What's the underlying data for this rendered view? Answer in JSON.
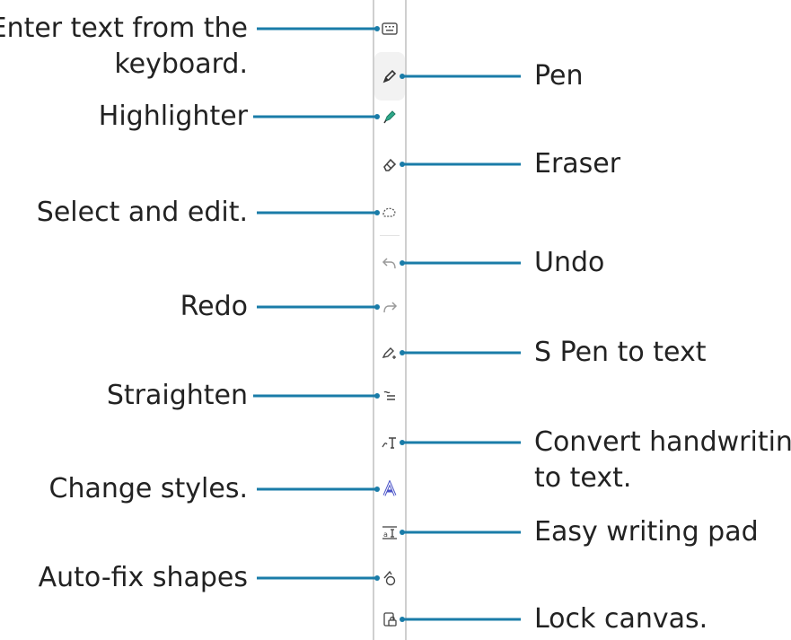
{
  "labels_left": {
    "keyboard_line1": "Enter text from the",
    "keyboard_line2": "keyboard.",
    "highlighter": "Highlighter",
    "select": "Select and edit.",
    "redo": "Redo",
    "straighten": "Straighten",
    "change_styles": "Change styles.",
    "auto_fix": "Auto-fix shapes"
  },
  "labels_right": {
    "pen": "Pen",
    "eraser": "Eraser",
    "undo": "Undo",
    "spen_to_text": "S Pen to text",
    "convert_line1": "Convert handwriting",
    "convert_line2": "to text.",
    "easy_pad": "Easy writing pad",
    "lock_canvas": "Lock canvas."
  },
  "colors": {
    "leader": "#1a7ca8",
    "highlighter_icon": "#2ea98a",
    "styles_icon": "#4a53c8"
  },
  "icons": [
    "keyboard-icon",
    "pen-icon",
    "highlighter-icon",
    "eraser-icon",
    "lasso-icon",
    "undo-icon",
    "redo-icon",
    "spen-to-text-icon",
    "straighten-icon",
    "convert-handwriting-icon",
    "change-styles-icon",
    "easy-writing-pad-icon",
    "auto-fix-shapes-icon",
    "lock-canvas-icon"
  ]
}
